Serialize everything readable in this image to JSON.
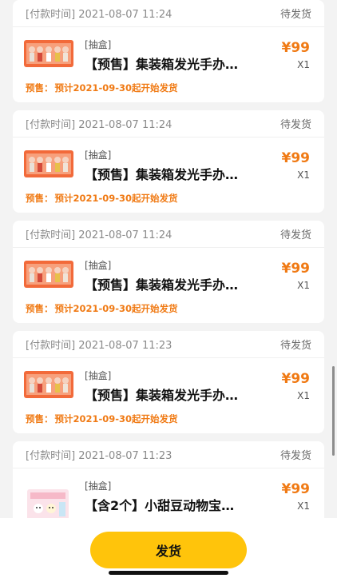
{
  "orders": [
    {
      "pay_time": "[付款时间] 2021-08-07 11:24",
      "status": "待发货",
      "tag": "[抽盒]",
      "name": "【预售】集装箱发光手办…",
      "price": "¥99",
      "qty": "X1",
      "presale_label": "预售：",
      "presale_text": "预计2021-09-30起开始发货",
      "image": "orange-figure-box"
    },
    {
      "pay_time": "[付款时间] 2021-08-07 11:24",
      "status": "待发货",
      "tag": "[抽盒]",
      "name": "【预售】集装箱发光手办…",
      "price": "¥99",
      "qty": "X1",
      "presale_label": "预售：",
      "presale_text": "预计2021-09-30起开始发货",
      "image": "orange-figure-box"
    },
    {
      "pay_time": "[付款时间] 2021-08-07 11:24",
      "status": "待发货",
      "tag": "[抽盒]",
      "name": "【预售】集装箱发光手办…",
      "price": "¥99",
      "qty": "X1",
      "presale_label": "预售：",
      "presale_text": "预计2021-09-30起开始发货",
      "image": "orange-figure-box"
    },
    {
      "pay_time": "[付款时间] 2021-08-07 11:23",
      "status": "待发货",
      "tag": "[抽盒]",
      "name": "【预售】集装箱发光手办…",
      "price": "¥99",
      "qty": "X1",
      "presale_label": "预售：",
      "presale_text": "预计2021-09-30起开始发货",
      "image": "orange-figure-box"
    },
    {
      "pay_time": "[付款时间] 2021-08-07 11:23",
      "status": "待发货",
      "tag": "[抽盒]",
      "name": "【含2个】小甜豆动物宝…",
      "price": "¥99",
      "qty": "X1",
      "image": "pink-animal-box"
    }
  ],
  "footer": {
    "ship_button": "发货"
  },
  "colors": {
    "accent": "#f07a14",
    "button": "#ffc40b"
  }
}
